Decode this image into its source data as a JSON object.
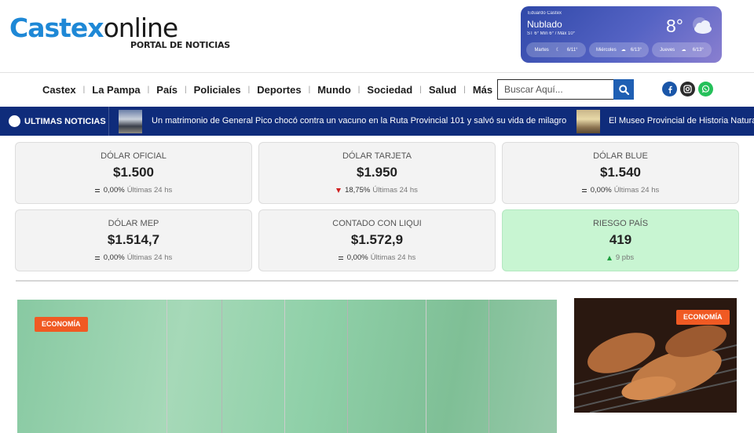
{
  "brand": {
    "name_part1": "Castex",
    "name_part2": "online",
    "tagline": "PORTAL DE NOTICIAS"
  },
  "weather": {
    "location": "Eduardo Castex",
    "condition": "Nublado",
    "details": "ST 6°   Mín 6° / Máx 10°",
    "temperature": "8°",
    "icon": "cloud-icon",
    "forecast": [
      {
        "day": "Martes",
        "range": "6/11°",
        "icon": "moon-cloud-icon"
      },
      {
        "day": "Miércoles",
        "range": "6/13°",
        "icon": "cloud-icon"
      },
      {
        "day": "Jueves",
        "range": "6/13°",
        "icon": "cloud-icon"
      }
    ]
  },
  "nav": {
    "items": [
      "Castex",
      "La Pampa",
      "País",
      "Policiales",
      "Deportes",
      "Mundo",
      "Sociedad",
      "Salud",
      "Más"
    ],
    "search_placeholder": "Buscar Aquí...",
    "social": [
      "facebook-icon",
      "instagram-icon",
      "whatsapp-icon"
    ]
  },
  "ticker": {
    "label": "ULTIMAS NOTICIAS",
    "items": [
      "Un matrimonio de General Pico chocó contra un vacuno en la Ruta Provincial 101 y salvó su vida de milagro",
      "El Museo Provincial de Historia Natural"
    ]
  },
  "currencies": [
    {
      "title": "DÓLAR OFICIAL",
      "value": "$1.500",
      "change": "0,00%",
      "period": "Últimas 24 hs",
      "trend": "equal"
    },
    {
      "title": "DÓLAR TARJETA",
      "value": "$1.950",
      "change": "18,75%",
      "period": "Últimas 24 hs",
      "trend": "down"
    },
    {
      "title": "DÓLAR BLUE",
      "value": "$1.540",
      "change": "0,00%",
      "period": "Últimas 24 hs",
      "trend": "equal"
    },
    {
      "title": "DÓLAR MEP",
      "value": "$1.514,7",
      "change": "0,00%",
      "period": "Últimas 24 hs",
      "trend": "equal"
    },
    {
      "title": "CONTADO CON LIQUI",
      "value": "$1.572,9",
      "change": "0,00%",
      "period": "Últimas 24 hs",
      "trend": "equal"
    },
    {
      "title": "RIESGO PAÍS",
      "value": "419",
      "change": "9 pbs",
      "period": "",
      "trend": "up"
    }
  ],
  "articles": [
    {
      "category": "ECONOMÍA"
    },
    {
      "category": "ECONOMÍA"
    }
  ],
  "colors": {
    "brand_blue": "#1e88d6",
    "nav_bar": "#0f2c7b",
    "category": "#f05a23",
    "risk_card": "#c8f5d2"
  }
}
